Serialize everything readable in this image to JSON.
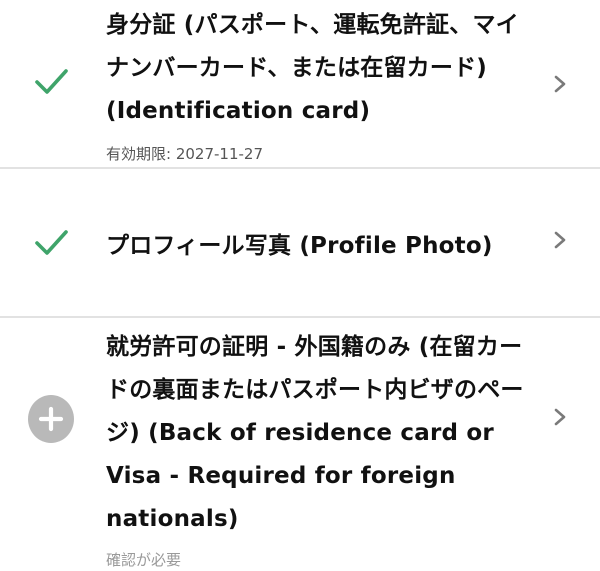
{
  "colors": {
    "check": "#3fa46a",
    "add_circle": "#b9b9b9",
    "chevron": "#7a7a7a",
    "divider": "#e2e2e2"
  },
  "documents": [
    {
      "status": "check",
      "title": "身分証 (パスポート、運転免許証、マイナンバーカード、または在留カード) (Identification card)",
      "subtitle": "有効期限: 2027-11-27"
    },
    {
      "status": "check",
      "title": "プロフィール写真 (Profile Photo)",
      "subtitle": ""
    },
    {
      "status": "plus",
      "title": "就労許可の証明 - 外国籍のみ (在留カードの裏面またはパスポート内ビザのページ) (Back of residence card or Visa - Required for foreign nationals)",
      "subtitle": "確認が必要"
    }
  ]
}
